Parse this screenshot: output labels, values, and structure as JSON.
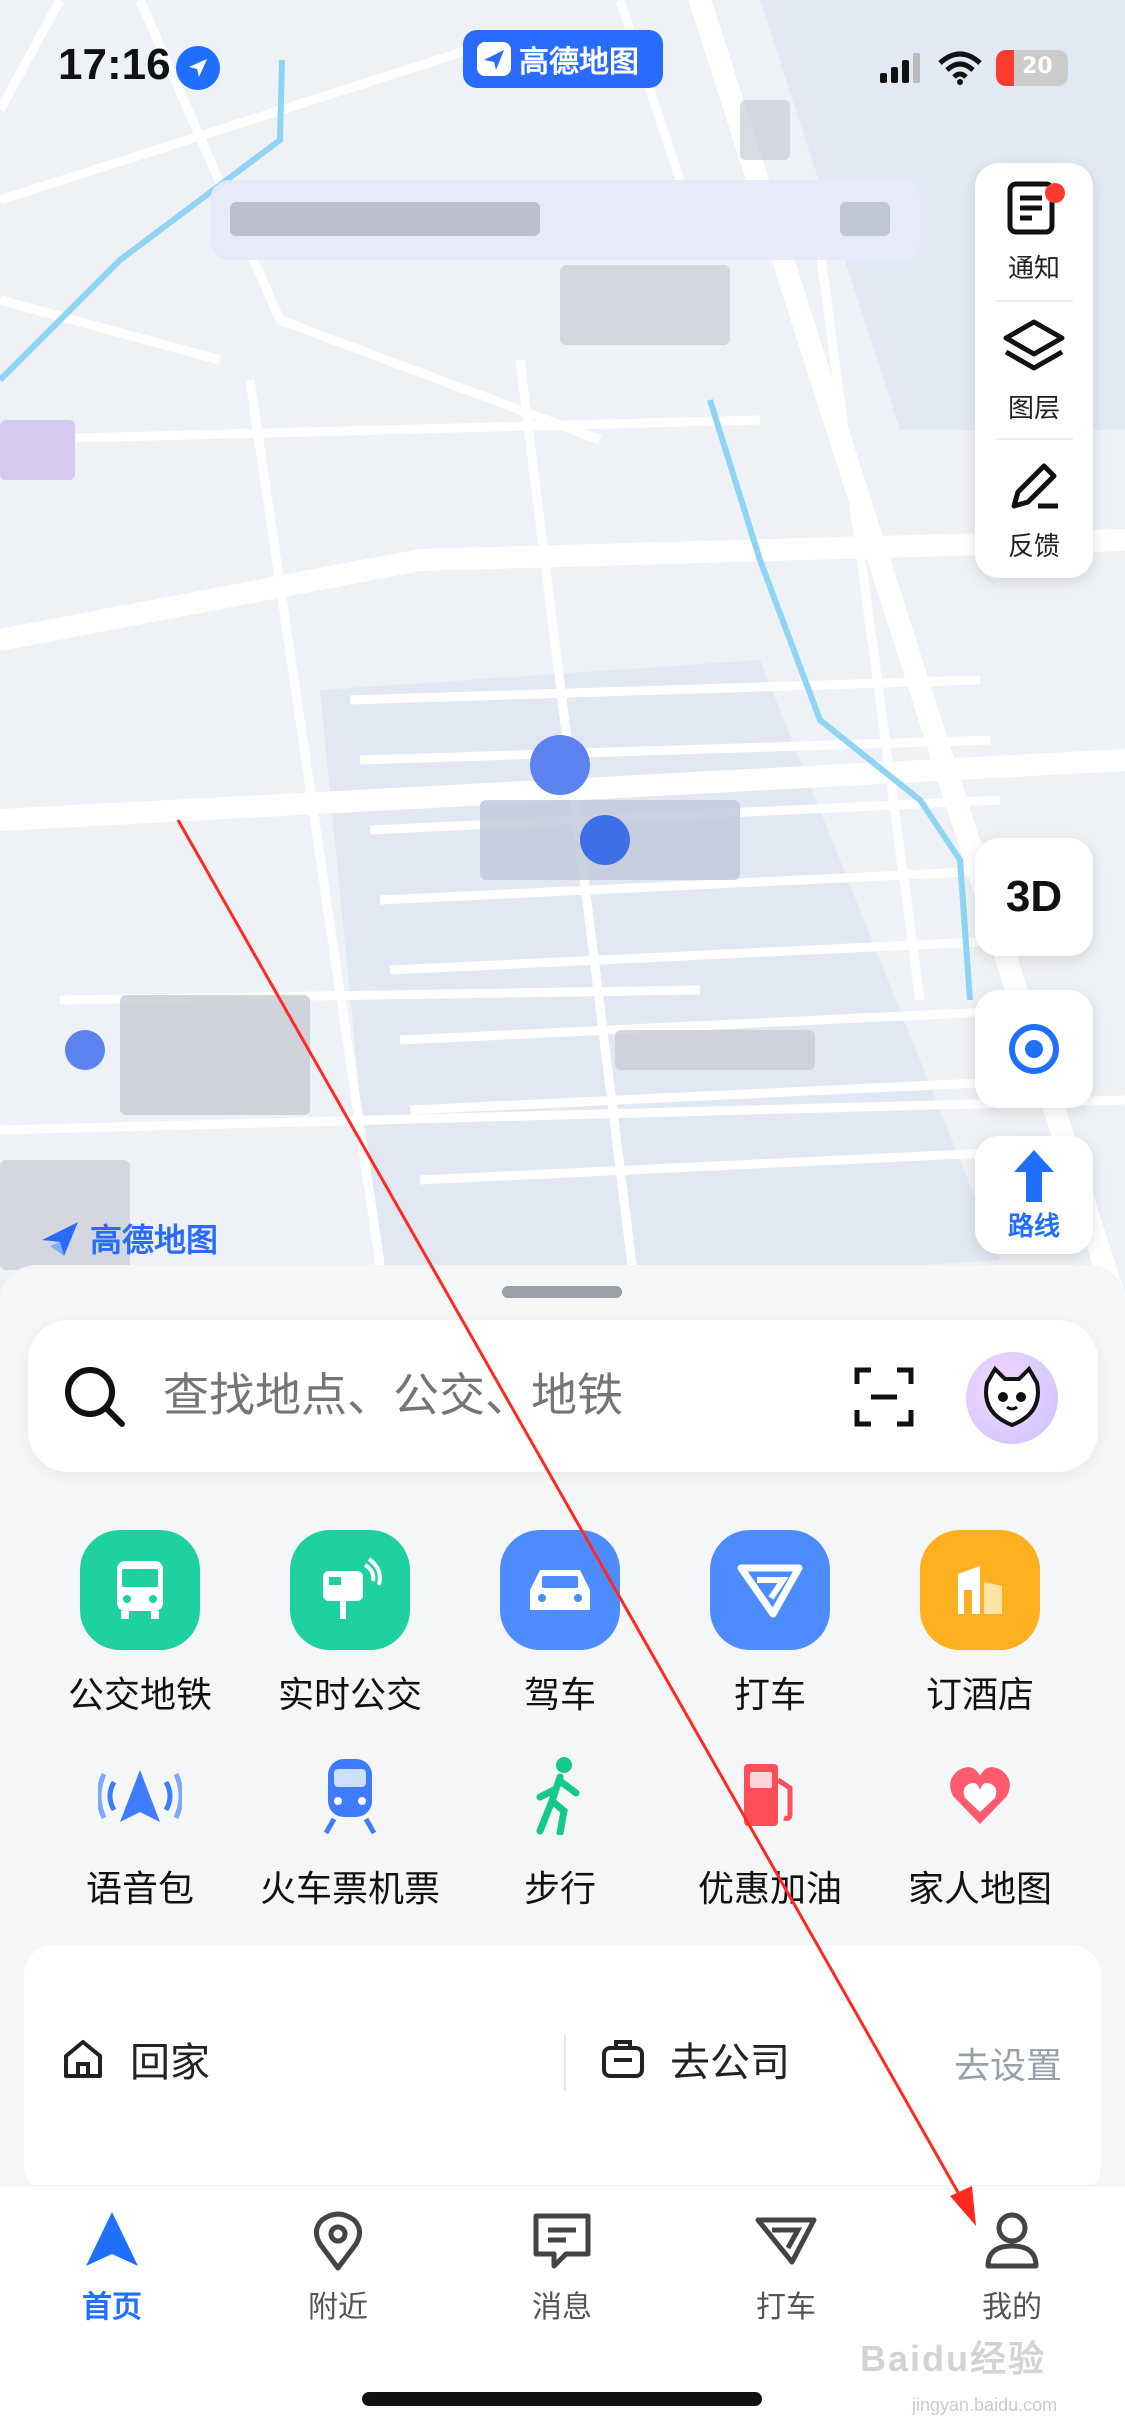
{
  "status_bar": {
    "time": "17:16",
    "battery_text": "20",
    "app_badge": "高德地图"
  },
  "map": {
    "notify_label": "通知",
    "layers_label": "图层",
    "feedback_label": "反馈",
    "threed_label": "3D",
    "route_label": "路线",
    "logo_text": "高德地图"
  },
  "search": {
    "placeholder": "查找地点、公交、地铁"
  },
  "services_primary": [
    {
      "label": "公交地铁",
      "icon": "bus-icon",
      "color": "#1fd1a0"
    },
    {
      "label": "实时公交",
      "icon": "realtime-bus-icon",
      "color": "#1fd1a0"
    },
    {
      "label": "驾车",
      "icon": "car-icon",
      "color": "#4d8cff"
    },
    {
      "label": "打车",
      "icon": "taxi-icon",
      "color": "#4d8cff"
    },
    {
      "label": "订酒店",
      "icon": "hotel-icon",
      "color": "#ffb020"
    }
  ],
  "services_secondary": [
    {
      "label": "语音包",
      "icon": "voice-pack-icon"
    },
    {
      "label": "火车票机票",
      "icon": "train-icon"
    },
    {
      "label": "步行",
      "icon": "walk-icon"
    },
    {
      "label": "优惠加油",
      "icon": "fuel-icon"
    },
    {
      "label": "家人地图",
      "icon": "family-map-icon"
    }
  ],
  "shortcuts": {
    "home": "回家",
    "work": "去公司",
    "settings": "去设置"
  },
  "tabs": [
    {
      "label": "首页",
      "icon": "home-nav-icon",
      "active": true
    },
    {
      "label": "附近",
      "icon": "nearby-icon",
      "active": false
    },
    {
      "label": "消息",
      "icon": "message-icon",
      "active": false
    },
    {
      "label": "打车",
      "icon": "taxi-tab-icon",
      "active": false
    },
    {
      "label": "我的",
      "icon": "profile-icon",
      "active": false
    }
  ],
  "watermark": {
    "text": "Baidu经验",
    "sub": "jingyan.baidu.com"
  },
  "colors": {
    "accent": "#1f6fff",
    "annotation": "#ff2a1f"
  }
}
